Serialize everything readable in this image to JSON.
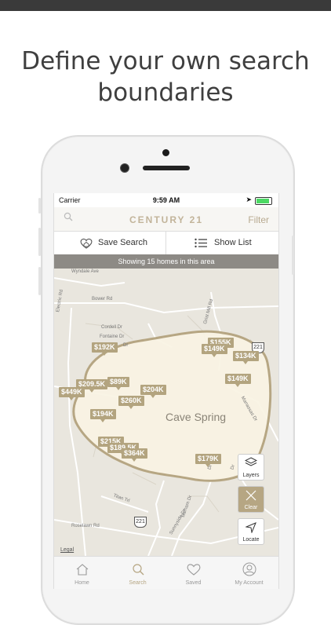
{
  "headline": {
    "line1": "Define your own search",
    "line2": "boundaries"
  },
  "status_bar": {
    "carrier": "Carrier",
    "time": "9:59 AM"
  },
  "nav": {
    "brand": "CENTURY 21",
    "filter": "Filter",
    "search_icon": "search-icon"
  },
  "actions": {
    "save_search": "Save Search",
    "show_list": "Show List"
  },
  "banner": {
    "text": "Showing 15 homes in this area"
  },
  "map": {
    "town": "Cave Spring",
    "roads": [
      "Wyndale Ave",
      "Bower Rd",
      "Electric Rd",
      "Cordell Dr",
      "Fontaine Dr",
      "Grist Mill Rd",
      "Manassas Dr",
      "Titan Trl",
      "Sunnyside Dr",
      "Barham Dr",
      "Roselawn Rd",
      "Dr",
      "Dr",
      "Dr"
    ],
    "route_shields": [
      "221",
      "221"
    ],
    "legal": "Legal",
    "prices": [
      "$192K",
      "$155K",
      "$149K",
      "$134K",
      "$89K",
      "$209.5K",
      "$449K",
      "$204K",
      "$260K",
      "$194K",
      "$149K",
      "$215K",
      "$189.5K",
      "$364K",
      "$179K"
    ]
  },
  "controls": {
    "layers": "Layers",
    "clear": "Clear",
    "locate": "Locate"
  },
  "tabs": [
    {
      "label": "Home",
      "icon": "home-icon"
    },
    {
      "label": "Search",
      "icon": "search-icon"
    },
    {
      "label": "Saved",
      "icon": "heart-house-icon"
    },
    {
      "label": "My Account",
      "icon": "user-icon"
    }
  ],
  "colors": {
    "accent": "#b6a683",
    "pin": "#b3a47f",
    "banner": "#8d8a85",
    "map_bg": "#e9e6de",
    "region_fill": "#f8f3e3"
  }
}
